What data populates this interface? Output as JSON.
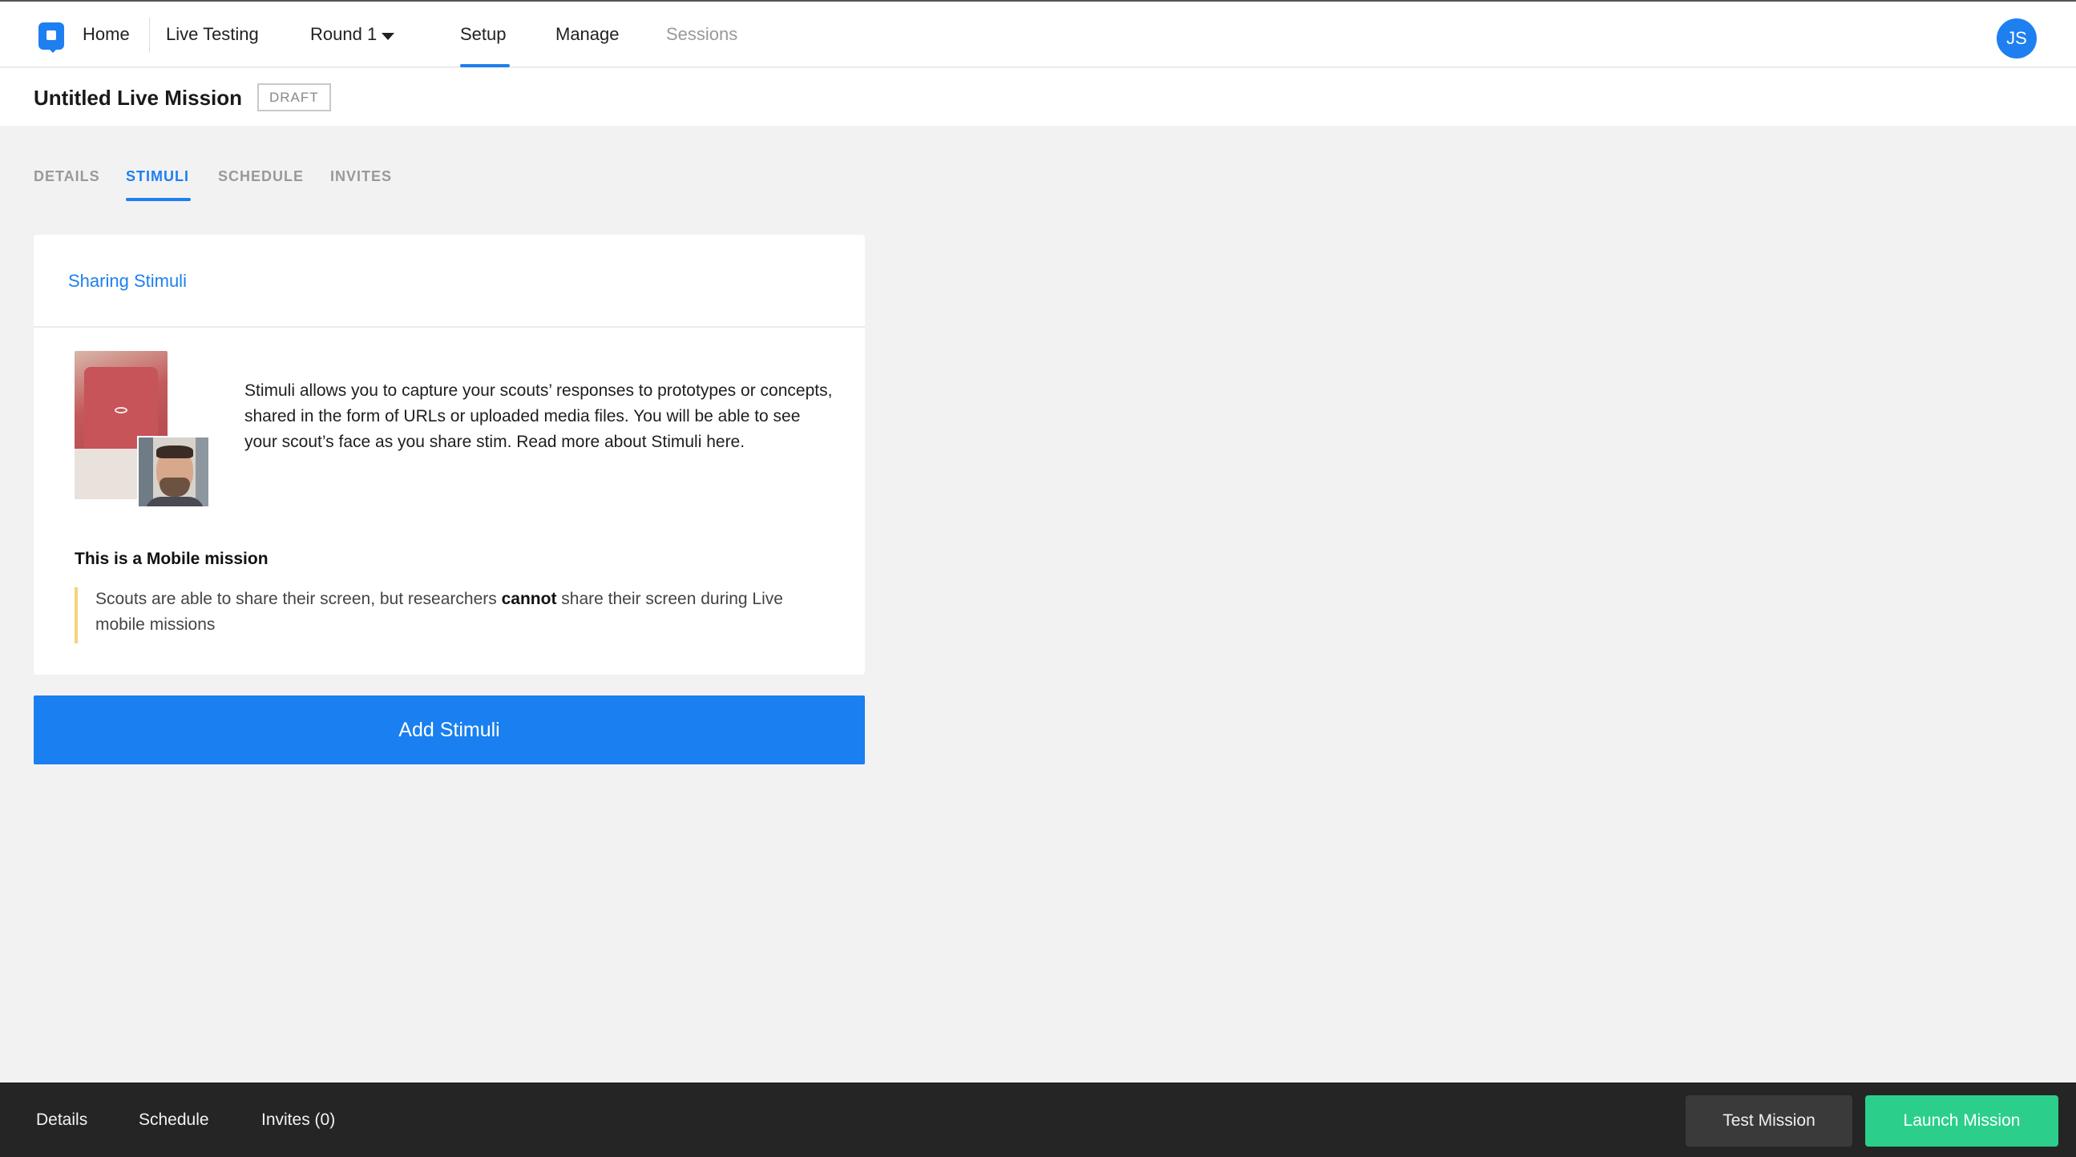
{
  "topnav": {
    "home_label": "Home",
    "product_label": "Live Testing",
    "round_label": "Round 1",
    "tabs": [
      {
        "label": "Setup",
        "active": true
      },
      {
        "label": "Manage",
        "active": false
      },
      {
        "label": "Sessions",
        "active": false
      }
    ],
    "avatar_initials": "JS"
  },
  "mission": {
    "title": "Untitled Live Mission",
    "status_badge": "DRAFT"
  },
  "section_tabs": [
    {
      "label": "DETAILS",
      "active": false
    },
    {
      "label": "STIMULI",
      "active": true
    },
    {
      "label": "SCHEDULE",
      "active": false
    },
    {
      "label": "INVITES",
      "active": false
    }
  ],
  "stimuli_card": {
    "header_title": "Sharing Stimuli",
    "description": "Stimuli allows you to capture your scouts’ responses to prototypes or concepts, shared in the form of URLs or uploaded media files. You will be able to see your scout’s face as you share stim. Read more about Stimuli here.",
    "mobile_heading": "This is a Mobile mission",
    "note_before": "Scouts are able to share their screen, but researchers ",
    "note_bold": "cannot",
    "note_after": " share their screen during Live mobile missions"
  },
  "add_button_label": "Add Stimuli",
  "bottombar": {
    "links": [
      "Details",
      "Schedule",
      "Invites (0)"
    ],
    "test_button": "Test Mission",
    "launch_button": "Launch Mission"
  },
  "colors": {
    "accent": "#1e7ff0",
    "launch": "#2bcf8b",
    "note_bar": "#f5d280",
    "bottombar": "#252525"
  }
}
